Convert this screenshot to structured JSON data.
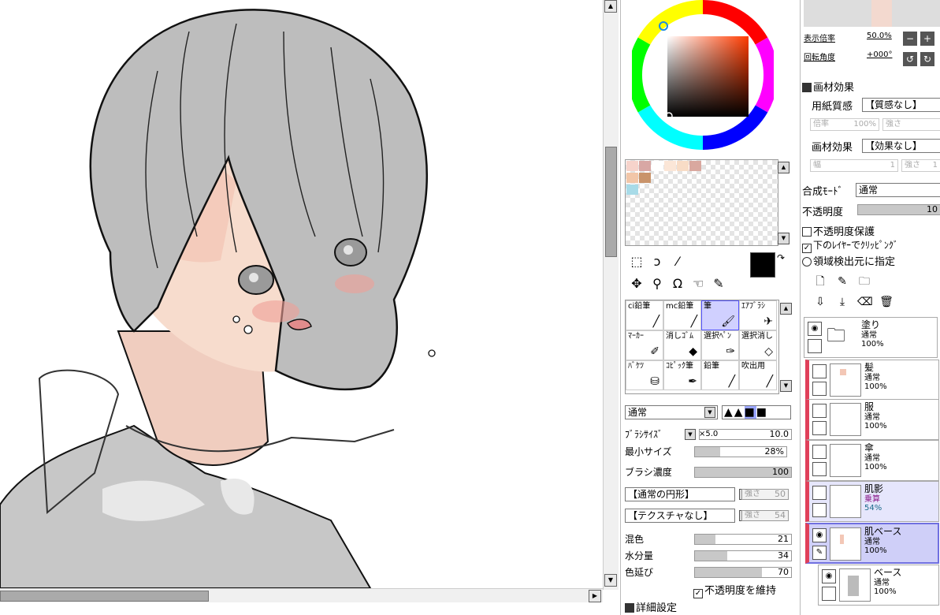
{
  "navigator": {
    "zoom_label": "表示倍率",
    "zoom_value": "50.0%",
    "rotation_label": "回転角度",
    "rotation_value": "+000°"
  },
  "material_effects": {
    "header": "画材効果",
    "paper_texture_label": "用紙質感",
    "paper_texture_value": "【質感なし】",
    "magnification_label": "倍率",
    "magnification_value": "100%",
    "strength_label": "強さ",
    "effect_label": "画材効果",
    "effect_value": "【効果なし】",
    "width_label": "幅",
    "width_value": "1",
    "strength2_label": "強さ",
    "strength2_value": "1"
  },
  "layer_props": {
    "blend_label": "合成ﾓｰﾄﾞ",
    "blend_value": "通常",
    "opacity_label": "不透明度",
    "opacity_value": "10",
    "protect_opacity": "不透明度保護",
    "clip_label": "下のﾚｲﾔｰでｸﾘｯﾋﾟﾝｸﾞ",
    "selection_source": "領域検出元に指定"
  },
  "swatches": [
    "#f6d3cb",
    "#d8a7a4",
    "#ffffff",
    "#fbe6d7",
    "#f8dcc6",
    "#d9a89f",
    "#f2c6a8",
    "#c9936a",
    "#a8dbe8"
  ],
  "colors": {
    "primary": "#000000",
    "secondary": "#ffffff",
    "accent_layer_clip": "#e0405a"
  },
  "brushes": [
    {
      "label": "ci鉛筆",
      "icon": "pencil-icon"
    },
    {
      "label": "mc鉛筆",
      "icon": "pencil-icon"
    },
    {
      "label": "筆",
      "icon": "brush-icon"
    },
    {
      "label": "ｴｱﾌﾞﾗｼ",
      "icon": "airbrush-icon"
    },
    {
      "label": "ﾏｰｶｰ",
      "icon": "marker-icon"
    },
    {
      "label": "消しｺﾞﾑ",
      "icon": "eraser-icon"
    },
    {
      "label": "選択ﾍﾟﾝ",
      "icon": "select-pen-icon"
    },
    {
      "label": "選択消し",
      "icon": "select-erase-icon"
    },
    {
      "label": "ﾊﾞｹﾂ",
      "icon": "bucket-icon"
    },
    {
      "label": "ｺﾋﾟｯｸ筆",
      "icon": "copic-icon"
    },
    {
      "label": "鉛筆",
      "icon": "pencil-icon"
    },
    {
      "label": "吹出用",
      "icon": "pen-icon"
    }
  ],
  "brush_settings": {
    "blend_mode": "通常",
    "size_label": "ﾌﾞﾗｼｻｲｽﾞ",
    "size_multiplier": "×5.0",
    "size_value": "10.0",
    "min_size_label": "最小サイズ",
    "min_size_value": "28%",
    "density_label": "ブラシ濃度",
    "density_value": "100",
    "shape": "【通常の円形】",
    "shape_strength_label": "強さ",
    "shape_strength": "50",
    "texture": "【テクスチャなし】",
    "texture_strength_label": "強さ",
    "texture_strength": "54",
    "blend_label": "混色",
    "blend_value": "21",
    "water_label": "水分量",
    "water_value": "34",
    "stretch_label": "色延び",
    "stretch_value": "70",
    "keep_opacity": "不透明度を維持",
    "detail": "詳細設定"
  },
  "layers": [
    {
      "name": "塗り",
      "mode": "通常",
      "opacity": "100%",
      "type": "folder"
    },
    {
      "name": "髪",
      "mode": "通常",
      "opacity": "100%"
    },
    {
      "name": "服",
      "mode": "通常",
      "opacity": "100%"
    },
    {
      "name": "傘",
      "mode": "通常",
      "opacity": "100%"
    },
    {
      "name": "肌影",
      "mode": "乗算",
      "opacity": "54%"
    },
    {
      "name": "肌ベース",
      "mode": "通常",
      "opacity": "100%"
    },
    {
      "name": "ベース",
      "mode": "通常",
      "opacity": "100%"
    }
  ]
}
